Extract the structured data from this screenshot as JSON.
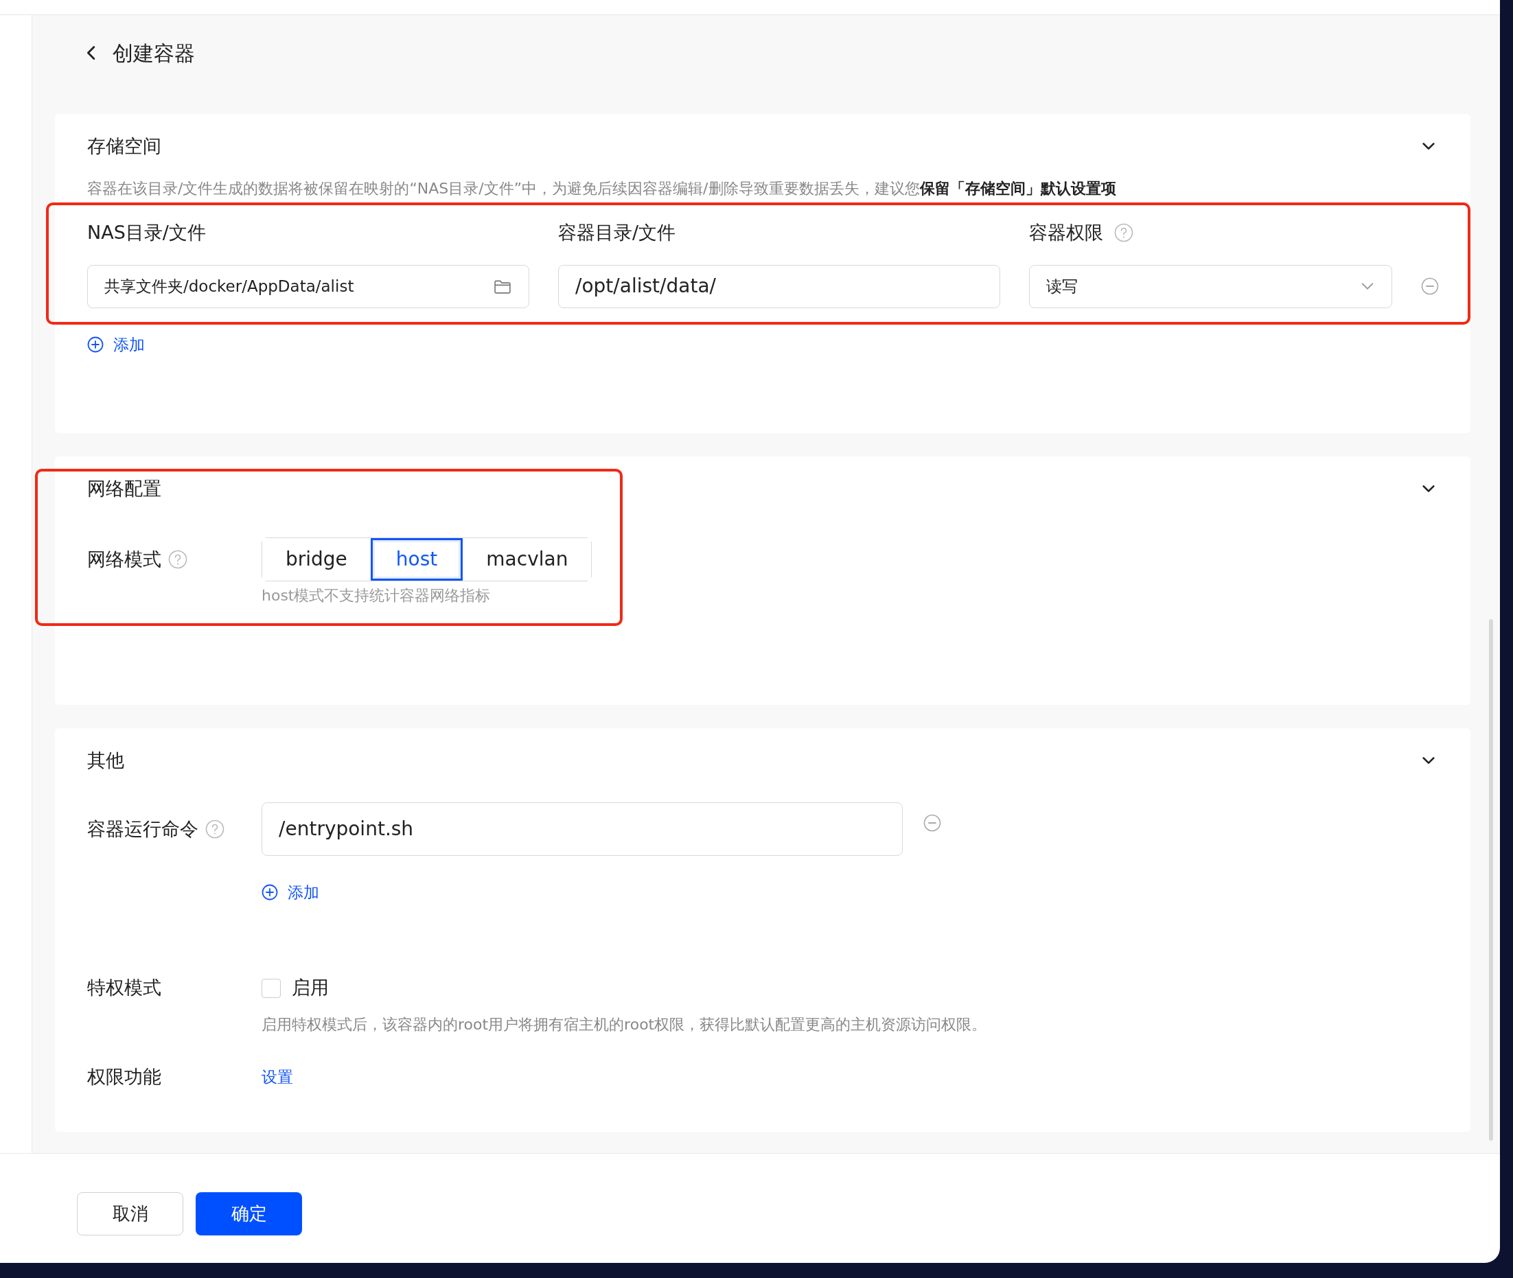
{
  "page": {
    "title": "创建容器"
  },
  "storage": {
    "title": "存储空间",
    "highlighted": true,
    "note": "容器在该目录/文件生成的数据将被保留在映射的“NAS目录/文件”中，为避免后续因容器编辑/删除导致重要数据丢失，建议您**保留「存储空间」默认设置项**",
    "columns": [
      "NAS目录/文件",
      "容器目录/文件",
      "容器权限"
    ],
    "mounts": [
      {
        "host_path": "共享文件夹/docker/AppData/alist",
        "container_path": "/opt/alist/data/",
        "permission": "读写"
      }
    ],
    "add_label": "添加"
  },
  "network": {
    "title": "网络配置",
    "highlighted": true,
    "mode_label": "网络模式",
    "modes": [
      {
        "label": "bridge",
        "selected": false
      },
      {
        "label": "host",
        "selected": true
      },
      {
        "label": "macvlan",
        "selected": false
      }
    ],
    "hint": "host模式不支持统计容器网络指标"
  },
  "other": {
    "title": "其他",
    "command_label": "容器运行命令",
    "commands": [
      {
        "value": "/entrypoint.sh"
      }
    ],
    "add_label": "添加",
    "privileged": {
      "label": "特权模式",
      "option": "启用",
      "checked": false,
      "description": "启用特权模式后，该容器内的root用户将拥有宿主机的root权限，获得比默认配置更高的主机资源访问权限。"
    },
    "capabilities": {
      "label": "权限功能",
      "link": "设置"
    }
  },
  "footer": {
    "buttons": [
      {
        "label": "取消",
        "kind": "secondary"
      },
      {
        "label": "确定",
        "kind": "primary"
      }
    ]
  }
}
